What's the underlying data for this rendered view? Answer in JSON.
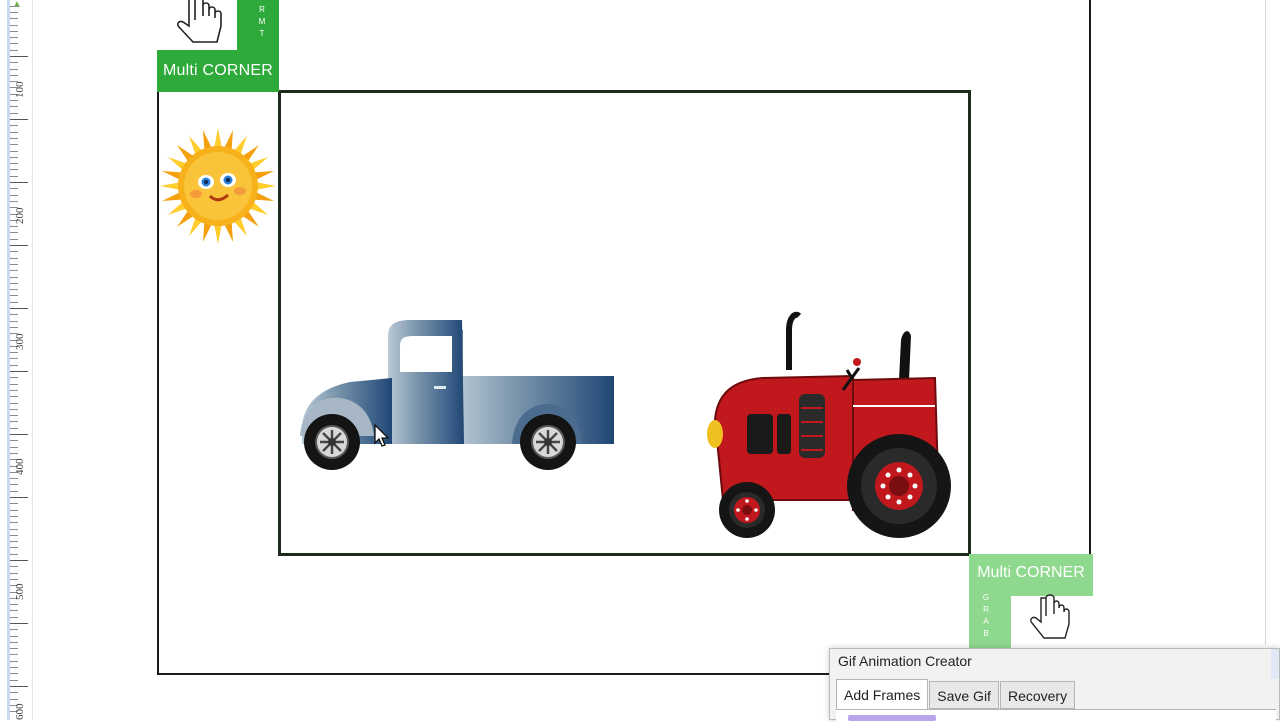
{
  "ruler": {
    "labels": [
      "100",
      "200",
      "300",
      "400",
      "500",
      "600"
    ]
  },
  "corners": {
    "top_left_label": "Multi CORNER",
    "top_left_vertical": "R M T",
    "bottom_right_label": "Multi CORNER",
    "bottom_right_vertical": "G R A B"
  },
  "gif_creator": {
    "title": "Gif Animation Creator",
    "tabs": [
      "Add Frames",
      "Save Gif",
      "Recovery"
    ],
    "active_tab": "Add Frames"
  },
  "colors": {
    "corner_green": "#2eaa3a",
    "corner_green_light": "#8fd98f",
    "truck_blue": "#6b8aa8",
    "tractor_red": "#c0181c"
  },
  "icons": [
    "hand-cursor-icon",
    "arrow-cursor-icon",
    "sun-icon",
    "truck-icon",
    "tractor-icon"
  ]
}
